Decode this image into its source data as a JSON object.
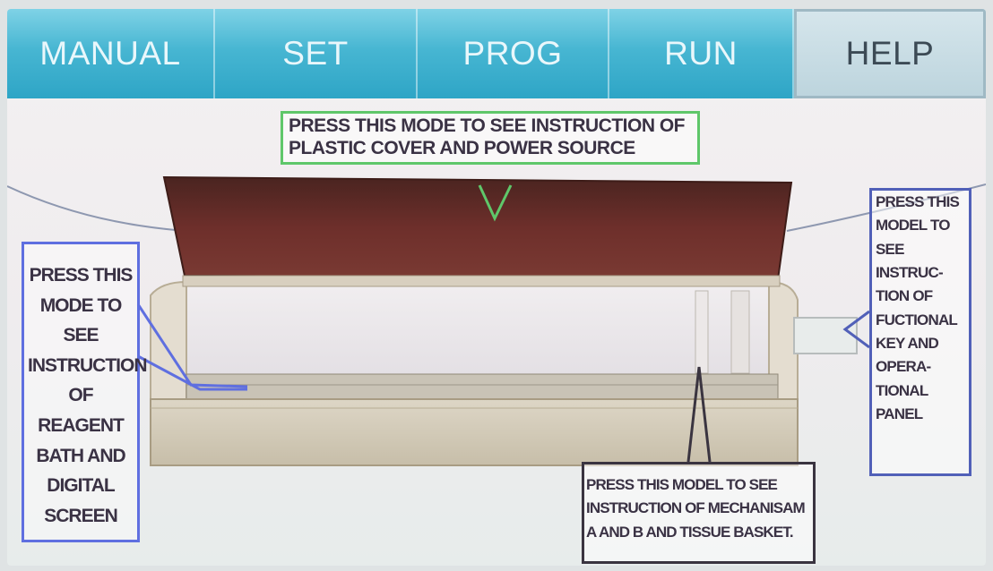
{
  "tabs": [
    {
      "label": "MANUAL"
    },
    {
      "label": "SET"
    },
    {
      "label": "PROG"
    },
    {
      "label": "RUN"
    },
    {
      "label": "HELP"
    }
  ],
  "active_tab": "HELP",
  "callouts": {
    "top": "PRESS THIS MODE TO SEE INSTRUCTION OF PLASTIC COVER AND POWER SOURCE",
    "left": "PRESS THIS MODE TO SEE INSTRUCTION OF REAGENT BATH AND DIGITAL SCREEN",
    "right": "PRESS THIS MODEL TO SEE INSTRUC-TION OF FUCTIONAL KEY AND OPERA-TIONAL PANEL",
    "bottom": "PRESS THIS MODEL TO SEE INSTRUCTION OF MECHANISAM A AND B AND TISSUE BASKET."
  },
  "colors": {
    "tabbar": "#2ea5c6",
    "top_callout_border": "#5fc76a",
    "left_callout_border": "#5f6fe0",
    "right_callout_border": "#5160b8",
    "bottom_callout_border": "#3a3440",
    "cover": "#6b2e2a"
  }
}
